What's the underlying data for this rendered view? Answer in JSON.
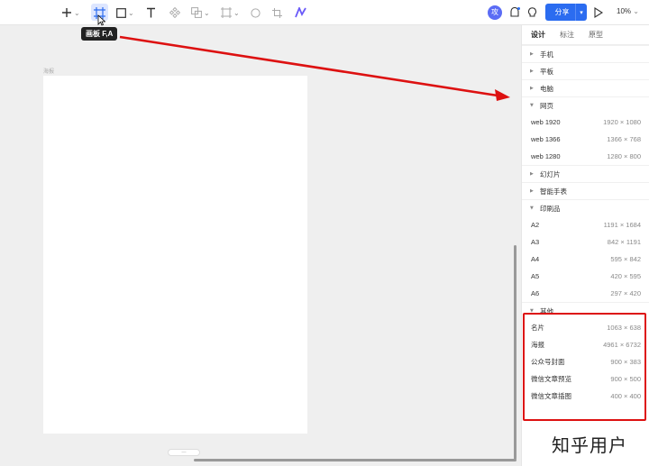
{
  "toolbar": {
    "tooltip": "画板 F,A",
    "user_initial": "攻",
    "share_label": "分享",
    "zoom": "10%"
  },
  "canvas": {
    "frame_label": "海报",
    "scroll_label": "—"
  },
  "panel": {
    "tabs": [
      "设计",
      "标注",
      "原型"
    ],
    "groups": [
      {
        "name": "手机",
        "expanded": false,
        "items": []
      },
      {
        "name": "平板",
        "expanded": false,
        "items": []
      },
      {
        "name": "电脑",
        "expanded": false,
        "items": []
      },
      {
        "name": "网页",
        "expanded": true,
        "items": [
          {
            "name": "web 1920",
            "size": "1920 × 1080"
          },
          {
            "name": "web 1366",
            "size": "1366 × 768"
          },
          {
            "name": "web 1280",
            "size": "1280 × 800"
          }
        ]
      },
      {
        "name": "幻灯片",
        "expanded": false,
        "items": []
      },
      {
        "name": "智能手表",
        "expanded": false,
        "items": []
      },
      {
        "name": "印刷品",
        "expanded": true,
        "items": [
          {
            "name": "A2",
            "size": "1191 × 1684"
          },
          {
            "name": "A3",
            "size": "842 × 1191"
          },
          {
            "name": "A4",
            "size": "595 × 842"
          },
          {
            "name": "A5",
            "size": "420 × 595"
          },
          {
            "name": "A6",
            "size": "297 × 420"
          }
        ]
      },
      {
        "name": "其他",
        "expanded": true,
        "items": [
          {
            "name": "名片",
            "size": "1063 × 638"
          },
          {
            "name": "海报",
            "size": "4961 × 6732"
          },
          {
            "name": "公众号封面",
            "size": "900 × 383"
          },
          {
            "name": "微信文章预览",
            "size": "900 × 500"
          },
          {
            "name": "微信文章插图",
            "size": "400 × 400"
          }
        ]
      }
    ]
  },
  "watermark": "知乎用户",
  "colors": {
    "accent": "#2b6cf0",
    "annotation": "#d11111",
    "avatar": "#5b6cf5"
  }
}
